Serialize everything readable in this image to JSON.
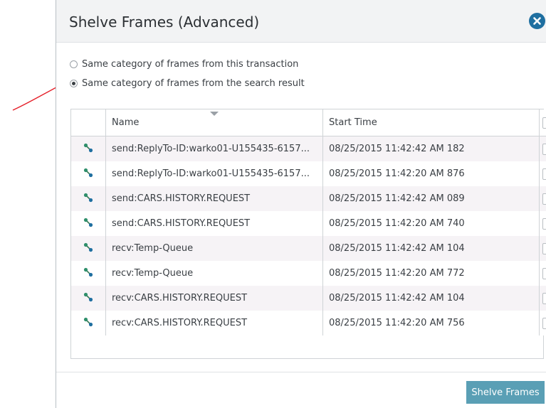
{
  "dialog": {
    "title": "Shelve Frames (Advanced)",
    "close_icon": "close-circle-icon",
    "accent_color": "#1f6fa0"
  },
  "options": [
    {
      "label": "Same category of frames from this transaction",
      "selected": false
    },
    {
      "label": "Same category of frames from the search result",
      "selected": true
    }
  ],
  "annotation": {
    "color": "#e5202a",
    "icon": "red-hand-drawn-arrow"
  },
  "table": {
    "columns": {
      "name": "Name",
      "start_time": "Start Time"
    },
    "sorted_column": "name",
    "row_icon": "connection-link-icon",
    "rows": [
      {
        "name": "send:ReplyTo-ID:warko01-U155435-6157...",
        "start_time": "08/25/2015 11:42:42 AM 182",
        "checked": false
      },
      {
        "name": "send:ReplyTo-ID:warko01-U155435-6157...",
        "start_time": "08/25/2015 11:42:20 AM 876",
        "checked": false
      },
      {
        "name": "send:CARS.HISTORY.REQUEST",
        "start_time": "08/25/2015 11:42:42 AM 089",
        "checked": false
      },
      {
        "name": "send:CARS.HISTORY.REQUEST",
        "start_time": "08/25/2015 11:42:20 AM 740",
        "checked": false
      },
      {
        "name": "recv:Temp-Queue",
        "start_time": "08/25/2015 11:42:42 AM 104",
        "checked": false
      },
      {
        "name": "recv:Temp-Queue",
        "start_time": "08/25/2015 11:42:20 AM 772",
        "checked": false
      },
      {
        "name": "recv:CARS.HISTORY.REQUEST",
        "start_time": "08/25/2015 11:42:42 AM 104",
        "checked": false
      },
      {
        "name": "recv:CARS.HISTORY.REQUEST",
        "start_time": "08/25/2015 11:42:20 AM 756",
        "checked": false
      }
    ]
  },
  "footer": {
    "primary_label": "Shelve Frames",
    "primary_color": "#5a9fb5"
  }
}
